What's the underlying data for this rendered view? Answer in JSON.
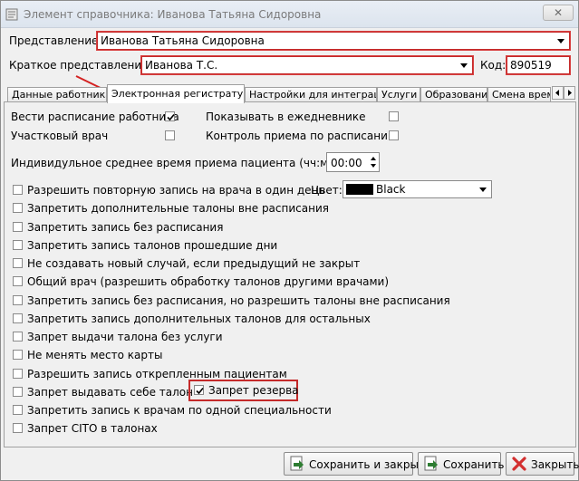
{
  "window": {
    "title": "Элемент справочника: Иванова Татьяна Сидоровна",
    "close_label": "✕"
  },
  "header": {
    "representation_label": "Представление:",
    "representation_value": "Иванова Татьяна Сидоровна",
    "short_label": "Краткое представление:",
    "short_value": "Иванова Т.С.",
    "code_label": "Код:",
    "code_value": "890519"
  },
  "tabs": [
    {
      "label": "Данные работника"
    },
    {
      "label": "Электронная регистратура"
    },
    {
      "label": "Настройки для интеграции"
    },
    {
      "label": "Услуги"
    },
    {
      "label": "Образование"
    },
    {
      "label": "Смена врем"
    }
  ],
  "options": {
    "keep_schedule": {
      "label": "Вести расписание работника",
      "checked": true
    },
    "show_in_diary": {
      "label": "Показывать в ежедневнике",
      "checked": false
    },
    "district_doctor": {
      "label": "Участковый врач",
      "checked": false
    },
    "control_by_schedule": {
      "label": "Контроль приема по расписанию",
      "checked": false
    }
  },
  "avg_time": {
    "label": "Индивидульное среднее время приема пациента (чч:мм)",
    "value": "00:00"
  },
  "color": {
    "label": "Цвет:",
    "value": "Black",
    "swatch_hex": "#000000"
  },
  "checkboxes": [
    {
      "label": "Разрешить повторную запись на врача в один день",
      "checked": false
    },
    {
      "label": "Запретить дополнительные талоны вне расписания",
      "checked": false
    },
    {
      "label": "Запретить запись без расписания",
      "checked": false
    },
    {
      "label": "Запретить запись талонов прошедшие дни",
      "checked": false
    },
    {
      "label": "Не создавать новый случай, если предыдущий не закрыт",
      "checked": false
    },
    {
      "label": "Общий врач (разрешить обработку талонов другими врачами)",
      "checked": false
    },
    {
      "label": "Запретить запись без расписания, но разрешить талоны вне расписания",
      "checked": false
    },
    {
      "label": "Запретить запись дополнительных талонов для остальных",
      "checked": false
    },
    {
      "label": "Запрет выдачи талона без услуги",
      "checked": false
    },
    {
      "label": "Не менять место карты",
      "checked": false
    },
    {
      "label": "Разрешить запись открепленным пациентам",
      "checked": false
    },
    {
      "label": "Запрет выдавать себе талон",
      "checked": false
    },
    {
      "label": "Запретить запись к врачам по одной специальности",
      "checked": false
    },
    {
      "label": "Запрет CITO в талонах",
      "checked": false
    }
  ],
  "reserve": {
    "label": "Запрет резерва",
    "checked": true
  },
  "buttons": {
    "save_close": "Сохранить и закрыть",
    "save": "Сохранить",
    "close": "Закрыть"
  },
  "colors": {
    "highlight": "#c42a2a",
    "save_icon": "#2e7d32",
    "close_icon": "#d32f2f"
  }
}
